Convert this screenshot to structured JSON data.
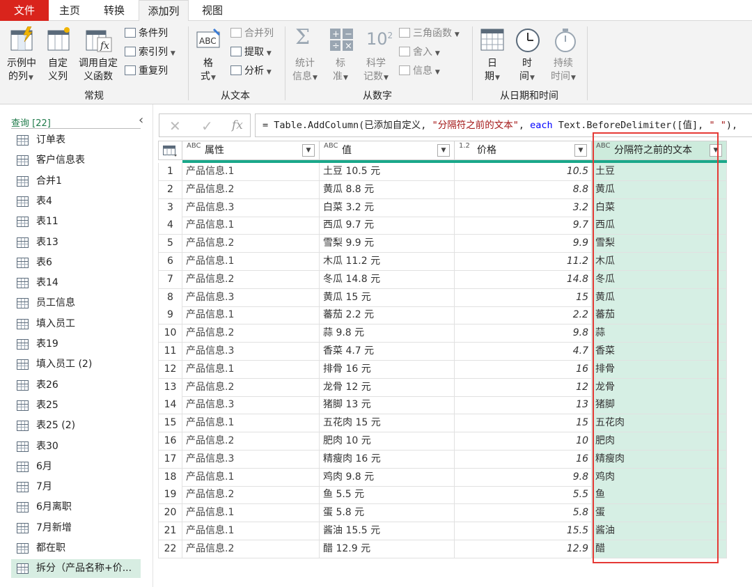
{
  "tabs": {
    "file": "文件",
    "home": "主页",
    "transform": "转换",
    "add_column": "添加列",
    "view": "视图"
  },
  "ribbon": {
    "example_col": [
      "示例中",
      "的列"
    ],
    "custom_col": [
      "自定",
      "义列"
    ],
    "invoke_func": [
      "调用自定",
      "义函数"
    ],
    "cond_col": "条件列",
    "index_col": "索引列",
    "dup_col": "重复列",
    "format": [
      "格",
      "式"
    ],
    "merge_cols": "合并列",
    "extract": "提取",
    "parse": "分析",
    "stats": [
      "统计",
      "信息"
    ],
    "standard": [
      "标",
      "准"
    ],
    "scientific": [
      "科学",
      "记数"
    ],
    "trig": "三角函数",
    "rounding": "舍入",
    "info": "信息",
    "date": [
      "日",
      "期"
    ],
    "time": [
      "时",
      "间"
    ],
    "duration": [
      "持续",
      "时间"
    ],
    "group_general": "常规",
    "group_text": "从文本",
    "group_number": "从数字",
    "group_datetime": "从日期和时间"
  },
  "queries": {
    "header": "查询 [22]",
    "items": [
      "订单表",
      "客户信息表",
      "合并1",
      "表4",
      "表11",
      "表13",
      "表6",
      "表14",
      "员工信息",
      "填入员工",
      "表19",
      "填入员工 (2)",
      "表26",
      "表25",
      "表25 (2)",
      "表30",
      "6月",
      "7月",
      "6月离职",
      "7月新增",
      "都在职",
      "拆分（产品名称+价..."
    ]
  },
  "formula": {
    "p1": "= Table.AddColumn(已添加自定义, ",
    "s1": "\"分隔符之前的文本\"",
    "p2": ", ",
    "kw": "each",
    "p3": " Text.BeforeDelimiter([值], ",
    "s2": "\" \"",
    "p4": "),"
  },
  "table": {
    "columns": [
      {
        "type": "ABC",
        "name": "属性"
      },
      {
        "type": "ABC",
        "name": "值"
      },
      {
        "type": "1.2",
        "name": "价格"
      },
      {
        "type": "ABC",
        "name": "分隔符之前的文本"
      }
    ],
    "rows": [
      [
        "1",
        "产品信息.1",
        "土豆 10.5 元",
        "10.5",
        "土豆"
      ],
      [
        "2",
        "产品信息.2",
        "黄瓜 8.8 元",
        "8.8",
        "黄瓜"
      ],
      [
        "3",
        "产品信息.3",
        "白菜 3.2 元",
        "3.2",
        "白菜"
      ],
      [
        "4",
        "产品信息.1",
        "西瓜 9.7 元",
        "9.7",
        "西瓜"
      ],
      [
        "5",
        "产品信息.2",
        "雪梨 9.9 元",
        "9.9",
        "雪梨"
      ],
      [
        "6",
        "产品信息.1",
        "木瓜 11.2 元",
        "11.2",
        "木瓜"
      ],
      [
        "7",
        "产品信息.2",
        "冬瓜 14.8 元",
        "14.8",
        "冬瓜"
      ],
      [
        "8",
        "产品信息.3",
        "黄瓜 15 元",
        "15",
        "黄瓜"
      ],
      [
        "9",
        "产品信息.1",
        "蕃茄 2.2 元",
        "2.2",
        "蕃茄"
      ],
      [
        "10",
        "产品信息.2",
        "蒜 9.8 元",
        "9.8",
        "蒜"
      ],
      [
        "11",
        "产品信息.3",
        "香菜 4.7 元",
        "4.7",
        "香菜"
      ],
      [
        "12",
        "产品信息.1",
        "排骨 16 元",
        "16",
        "排骨"
      ],
      [
        "13",
        "产品信息.2",
        "龙骨 12 元",
        "12",
        "龙骨"
      ],
      [
        "14",
        "产品信息.3",
        "猪脚 13 元",
        "13",
        "猪脚"
      ],
      [
        "15",
        "产品信息.1",
        "五花肉 15 元",
        "15",
        "五花肉"
      ],
      [
        "16",
        "产品信息.2",
        "肥肉 10 元",
        "10",
        "肥肉"
      ],
      [
        "17",
        "产品信息.3",
        "精瘦肉 16 元",
        "16",
        "精瘦肉"
      ],
      [
        "18",
        "产品信息.1",
        "鸡肉 9.8 元",
        "9.8",
        "鸡肉"
      ],
      [
        "19",
        "产品信息.2",
        "鱼 5.5 元",
        "5.5",
        "鱼"
      ],
      [
        "20",
        "产品信息.1",
        "蛋 5.8 元",
        "5.8",
        "蛋"
      ],
      [
        "21",
        "产品信息.1",
        "酱油 15.5 元",
        "15.5",
        "酱油"
      ],
      [
        "22",
        "产品信息.2",
        "醋 12.9 元",
        "12.9",
        "醋"
      ]
    ]
  }
}
